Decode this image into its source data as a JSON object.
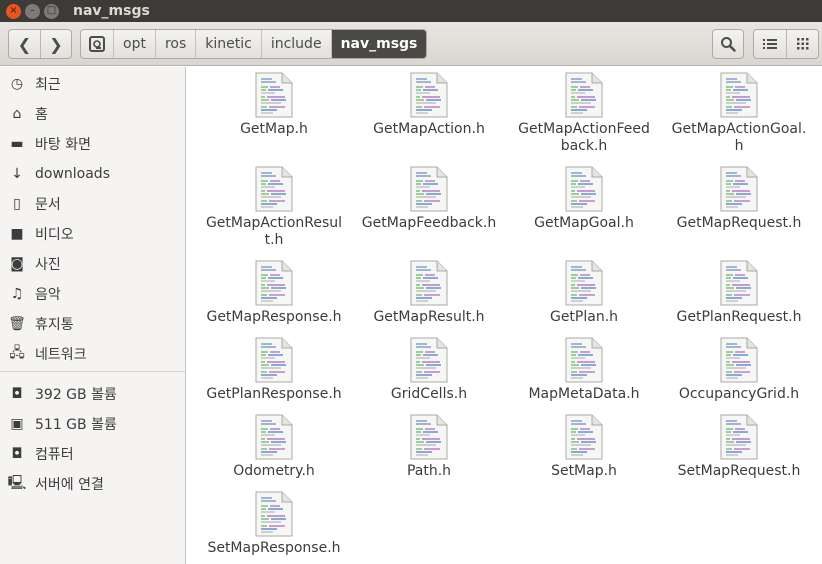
{
  "window": {
    "title": "nav_msgs",
    "close_glyph": "×",
    "minimize_glyph": "–",
    "maximize_glyph": "□"
  },
  "toolbar": {
    "back_glyph": "❮",
    "forward_glyph": "❯",
    "search_glyph": "🔍",
    "list_view_glyph": "☰",
    "grid_view_glyph": "⋮⋮⋮"
  },
  "breadcrumbs": [
    "opt",
    "ros",
    "kinetic",
    "include",
    "nav_msgs"
  ],
  "sidebar": {
    "places": [
      {
        "label": "최근",
        "icon": "clock-icon",
        "glyph": "◷"
      },
      {
        "label": "홈",
        "icon": "home-icon",
        "glyph": "⌂"
      },
      {
        "label": "바탕 화면",
        "icon": "folder-icon",
        "glyph": "▬"
      },
      {
        "label": "downloads",
        "icon": "download-icon",
        "glyph": "↓"
      },
      {
        "label": "문서",
        "icon": "document-icon",
        "glyph": "▯"
      },
      {
        "label": "비디오",
        "icon": "video-icon",
        "glyph": "■"
      },
      {
        "label": "사진",
        "icon": "camera-icon",
        "glyph": "◙"
      },
      {
        "label": "음악",
        "icon": "music-icon",
        "glyph": "♫"
      },
      {
        "label": "휴지통",
        "icon": "trash-icon",
        "glyph": "🗑"
      },
      {
        "label": "네트워크",
        "icon": "network-icon",
        "glyph": "🖧"
      }
    ],
    "devices": [
      {
        "label": "392 GB 볼륨",
        "icon": "drive-icon",
        "glyph": "◘"
      },
      {
        "label": "511 GB 볼륨",
        "icon": "drive-icon",
        "glyph": "▣"
      },
      {
        "label": "컴퓨터",
        "icon": "computer-icon",
        "glyph": "◘"
      },
      {
        "label": "서버에 연결",
        "icon": "server-icon",
        "glyph": "🖳"
      }
    ]
  },
  "files": [
    "GetMap.h",
    "GetMapAction.h",
    "GetMapActionFeedback.h",
    "GetMapActionGoal.h",
    "GetMapActionResult.h",
    "GetMapFeedback.h",
    "GetMapGoal.h",
    "GetMapRequest.h",
    "GetMapResponse.h",
    "GetMapResult.h",
    "GetPlan.h",
    "GetPlanRequest.h",
    "GetPlanResponse.h",
    "GridCells.h",
    "MapMetaData.h",
    "OccupancyGrid.h",
    "Odometry.h",
    "Path.h",
    "SetMap.h",
    "SetMapRequest.h",
    "SetMapResponse.h"
  ]
}
